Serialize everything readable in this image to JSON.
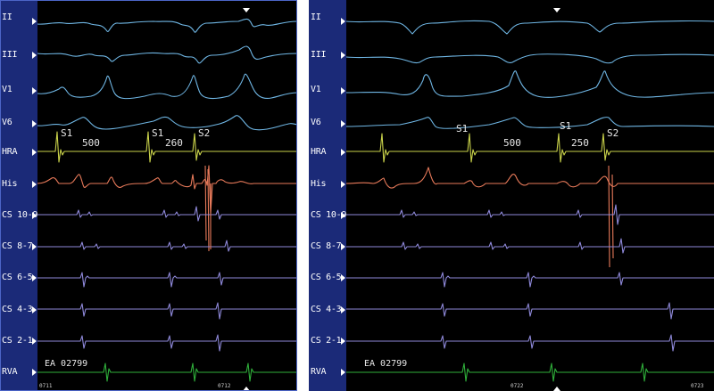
{
  "leads": [
    "II",
    "III",
    "V1",
    "V6",
    "HRA",
    "His",
    "CS 10-9",
    "CS 8-7",
    "CS 6-5",
    "CS 4-3",
    "CS 2-1",
    "RVA"
  ],
  "colors": {
    "sidebar": "#1b2a78",
    "surface_ecg": "#6fb6e4",
    "hra": "#c9d24a",
    "his": "#e87a5a",
    "cs": "#8e88d9",
    "rva": "#2fae3a",
    "frame": "#4c65c7"
  },
  "panels": [
    {
      "id": "left",
      "measurements": [
        {
          "label": "S1"
        },
        {
          "label": "500"
        },
        {
          "label": "S1"
        },
        {
          "label": "260"
        },
        {
          "label": "S2"
        }
      ],
      "ea_label": "EA 02799",
      "footer_ticks": [
        "0711",
        "0712"
      ]
    },
    {
      "id": "right",
      "measurements": [
        {
          "label": "S1"
        },
        {
          "label": "500"
        },
        {
          "label": "S1"
        },
        {
          "label": "250"
        },
        {
          "label": "S2"
        }
      ],
      "ea_label": "EA 02799",
      "footer_ticks": [
        "0722",
        "0723"
      ]
    }
  ]
}
